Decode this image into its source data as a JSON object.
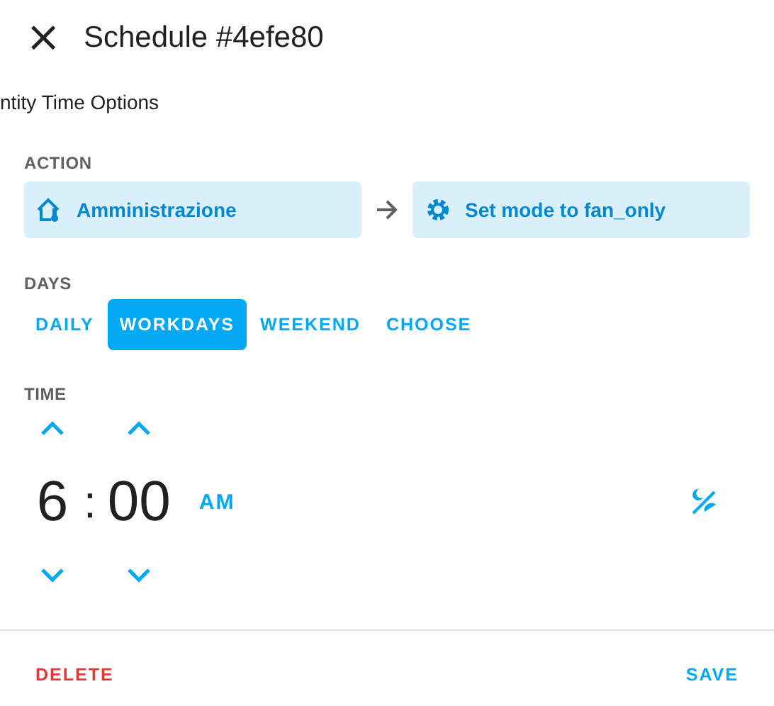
{
  "dialog": {
    "title": "Schedule #4efe80",
    "close": "×"
  },
  "subtitle": "ntity Time Options",
  "action": {
    "label": "ACTION",
    "entity": "Amministrazione",
    "service": "Set mode to fan_only"
  },
  "days": {
    "label": "DAYS",
    "options": [
      {
        "label": "DAILY",
        "selected": false
      },
      {
        "label": "WORKDAYS",
        "selected": true
      },
      {
        "label": "WEEKEND",
        "selected": false
      },
      {
        "label": "CHOOSE",
        "selected": false
      }
    ]
  },
  "time": {
    "label": "TIME",
    "hours": "6",
    "separator": ":",
    "minutes": "00",
    "period": "AM"
  },
  "buttons": {
    "delete": "DELETE",
    "save": "SAVE"
  }
}
